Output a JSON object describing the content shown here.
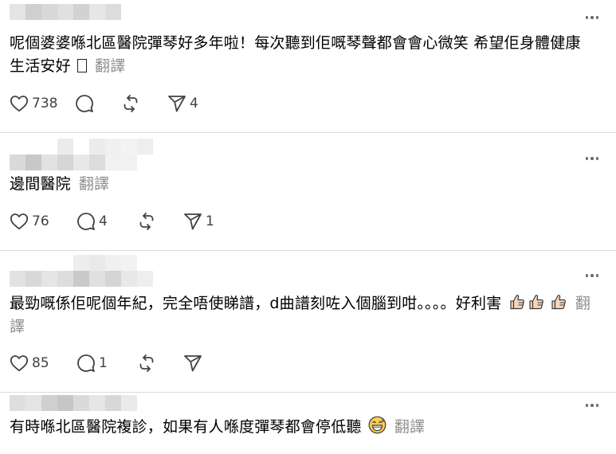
{
  "comments": [
    {
      "text": "呢個婆婆喺北區醫院彈琴好多年啦！每次聽到佢嘅琴聲都會會心微笑 希望佢身體健康生活安好 ",
      "trailing_glyph": "ロ",
      "translate_label": "翻譯",
      "likes": "738",
      "replies": "",
      "shares": "4"
    },
    {
      "text": "邊間醫院",
      "translate_label": "翻譯",
      "likes": "76",
      "replies": "4",
      "shares": "1"
    },
    {
      "text": "最勁嘅係佢呢個年紀，完全唔使睇譜，d曲譜刻咗入個腦到咁。。。。好利害",
      "translate_label": "翻譯",
      "likes": "85",
      "replies": "1",
      "shares": ""
    },
    {
      "text": "有時喺北區醫院複診，如果有人喺度彈琴都會停低聽",
      "translate_label": "翻譯"
    }
  ],
  "icons": {
    "more": "more-horizontal-icon",
    "like": "heart-icon",
    "reply": "comment-bubble-icon",
    "repost": "repost-arrows-icon",
    "share": "paper-plane-icon",
    "thumbs_up": "thumbs-up-emoji",
    "laugh": "grinning-sweat-emoji"
  },
  "colors": {
    "text": "#000000",
    "muted": "#8e8e8e",
    "icon": "#424242",
    "divider": "#dbdbdb"
  }
}
